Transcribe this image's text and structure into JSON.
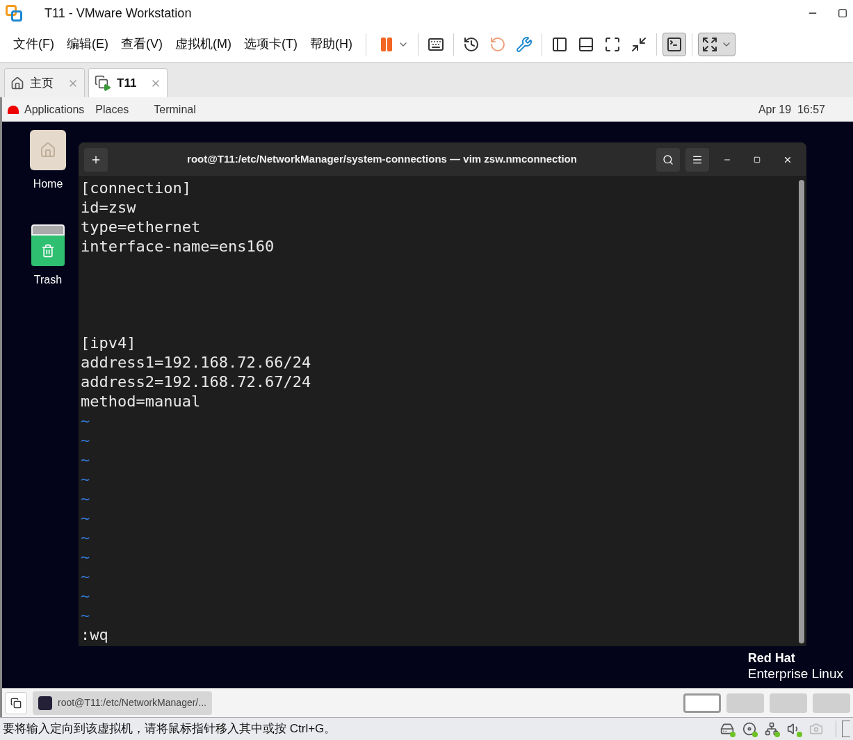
{
  "window": {
    "title": "T11 - VMware Workstation"
  },
  "menu": [
    "文件(F)",
    "编辑(E)",
    "查看(V)",
    "虚拟机(M)",
    "选项卡(T)",
    "帮助(H)"
  ],
  "toolbar": [
    {
      "kind": "pause"
    },
    {
      "kind": "sep"
    },
    {
      "kind": "send-keys"
    },
    {
      "kind": "sep"
    },
    {
      "kind": "snapshot"
    },
    {
      "kind": "revert"
    },
    {
      "kind": "manage"
    },
    {
      "kind": "sep"
    },
    {
      "kind": "sidebar"
    },
    {
      "kind": "bottombar"
    },
    {
      "kind": "fullscreen"
    },
    {
      "kind": "unity"
    },
    {
      "kind": "sep"
    },
    {
      "kind": "console",
      "selected": true
    },
    {
      "kind": "sep"
    },
    {
      "kind": "stretch",
      "selected": true
    }
  ],
  "tabs": [
    {
      "label": "主页",
      "kind": "home",
      "selected": false
    },
    {
      "label": "T11",
      "kind": "vm",
      "selected": true
    }
  ],
  "guest": {
    "topbar": {
      "items": [
        "Applications",
        "Places",
        "Terminal"
      ],
      "clock": "Apr 19  16:57"
    },
    "desktop_icons": [
      {
        "label": "Home",
        "kind": "folder"
      },
      {
        "label": "Trash",
        "kind": "trash"
      }
    ],
    "logo": {
      "line1": "Red Hat",
      "line2": "Enterprise Linux"
    },
    "terminal": {
      "title": "root@T11:/etc/NetworkManager/system-connections — vim zsw.nmconnection",
      "lines": [
        {
          "kind": "text",
          "text": "[connection]"
        },
        {
          "kind": "text",
          "text": "id=zsw"
        },
        {
          "kind": "text",
          "text": "type=ethernet"
        },
        {
          "kind": "text",
          "text": "interface-name=ens160"
        },
        {
          "kind": "blank"
        },
        {
          "kind": "blank"
        },
        {
          "kind": "blank"
        },
        {
          "kind": "blank"
        },
        {
          "kind": "text",
          "text": "[ipv4]"
        },
        {
          "kind": "text",
          "text": "address1=192.168.72.66/24"
        },
        {
          "kind": "text",
          "text": "address2=192.168.72.67/24"
        },
        {
          "kind": "text",
          "text": "method=manual"
        },
        {
          "kind": "tilde",
          "text": "~"
        },
        {
          "kind": "tilde",
          "text": "~"
        },
        {
          "kind": "tilde",
          "text": "~"
        },
        {
          "kind": "tilde",
          "text": "~"
        },
        {
          "kind": "tilde",
          "text": "~"
        },
        {
          "kind": "tilde",
          "text": "~"
        },
        {
          "kind": "tilde",
          "text": "~"
        },
        {
          "kind": "tilde",
          "text": "~"
        },
        {
          "kind": "tilde",
          "text": "~"
        },
        {
          "kind": "tilde",
          "text": "~"
        },
        {
          "kind": "tilde",
          "text": "~"
        }
      ],
      "command": ":wq"
    },
    "taskbar": {
      "window": "root@T11:/etc/NetworkManager/...",
      "workspaces": [
        {
          "selected": true
        },
        {
          "selected": false
        },
        {
          "selected": false
        },
        {
          "selected": false
        }
      ]
    }
  },
  "status_bar": {
    "message": "要将输入定向到该虚拟机，请将鼠标指针移入其中或按 Ctrl+G。",
    "devices": [
      {
        "kind": "disk",
        "active": true
      },
      {
        "kind": "cd",
        "active": true
      },
      {
        "kind": "network",
        "active": true
      },
      {
        "kind": "sound",
        "active": true
      },
      {
        "kind": "camera",
        "active": false
      }
    ]
  }
}
